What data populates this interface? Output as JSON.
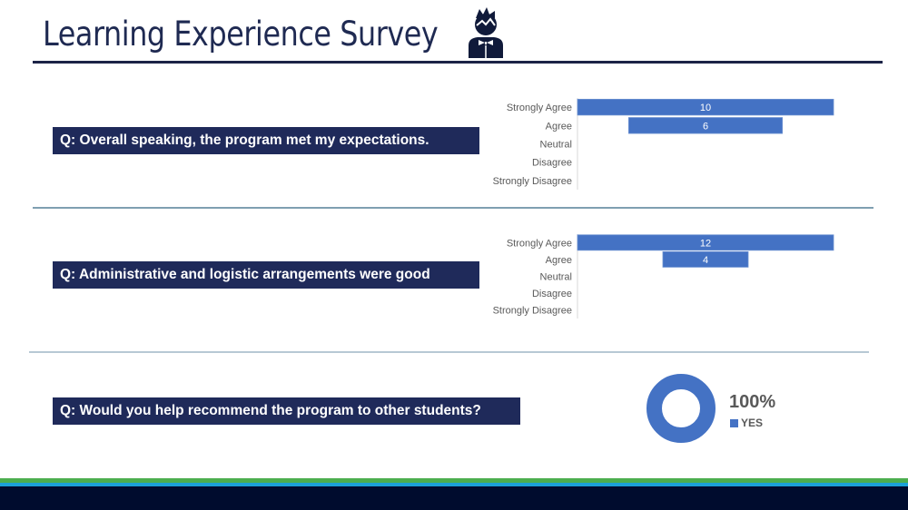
{
  "header": {
    "title": "Learning Experience Survey",
    "icon": "person-bowtie-icon"
  },
  "questions": [
    {
      "label": "Q: Overall speaking, the program met my expectations."
    },
    {
      "label": "Q: Administrative and logistic arrangements were good"
    },
    {
      "label": "Q: Would you help recommend the program to other students?"
    }
  ],
  "colors": {
    "bar": "#4472c4",
    "question_bg": "#1f2a5a",
    "title": "#1f2a52",
    "footer_green": "#4cae4f",
    "footer_blue": "#1ba1d8",
    "footer_navy": "#000c2e"
  },
  "chart_data": [
    {
      "type": "bar",
      "orientation": "horizontal",
      "style": "centered",
      "title": "Q: Overall speaking, the program met my expectations.",
      "categories": [
        "Strongly Agree",
        "Agree",
        "Neutral",
        "Disagree",
        "Strongly Disagree"
      ],
      "values": [
        10,
        6,
        0,
        0,
        0
      ],
      "data_labels": [
        "10",
        "6",
        "",
        "",
        ""
      ],
      "xlim": [
        0,
        10
      ],
      "grid": false
    },
    {
      "type": "bar",
      "orientation": "horizontal",
      "style": "centered",
      "title": "Q: Administrative and logistic arrangements were good",
      "categories": [
        "Strongly Agree",
        "Agree",
        "Neutral",
        "Disagree",
        "Strongly Disagree"
      ],
      "values": [
        12,
        4,
        0,
        0,
        0
      ],
      "data_labels": [
        "12",
        "4",
        "",
        "",
        ""
      ],
      "xlim": [
        0,
        12
      ],
      "grid": false
    },
    {
      "type": "pie",
      "style": "donut",
      "title": "Q: Would you help recommend the program to other students?",
      "categories": [
        "YES"
      ],
      "values": [
        100
      ],
      "data_label": "100%",
      "legend": [
        "YES"
      ],
      "legend_position": "right"
    }
  ]
}
